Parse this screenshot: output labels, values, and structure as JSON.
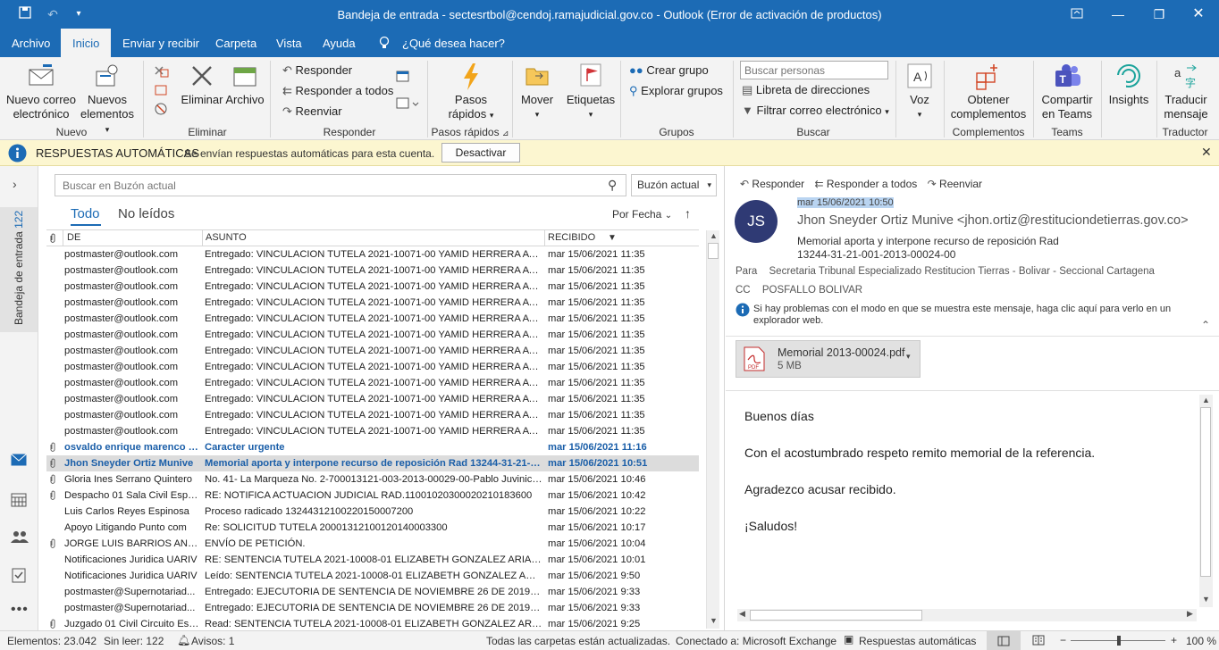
{
  "titlebar": {
    "title": "Bandeja de entrada - sectesrtbol@cendoj.ramajudicial.gov.co  -  Outlook (Error de activación de productos)"
  },
  "menu": {
    "tabs": [
      "Archivo",
      "Inicio",
      "Enviar y recibir",
      "Carpeta",
      "Vista",
      "Ayuda"
    ],
    "tell_me": "¿Qué desea hacer?"
  },
  "ribbon": {
    "new_email": "Nuevo correo electrónico",
    "new_email_l1": "Nuevo correo",
    "new_email_l2": "electrónico",
    "new_items_l1": "Nuevos",
    "new_items_l2": "elementos",
    "group_new": "Nuevo",
    "delete": "Eliminar",
    "archive": "Archivo",
    "group_delete": "Eliminar",
    "reply": "Responder",
    "reply_all": "Responder a todos",
    "forward": "Reenviar",
    "group_respond": "Responder",
    "quick_steps_l1": "Pasos",
    "quick_steps_l2": "rápidos",
    "group_quick": "Pasos rápidos",
    "move": "Mover",
    "tags": "Etiquetas",
    "create_group": "Crear grupo",
    "browse_groups": "Explorar grupos",
    "group_groups": "Grupos",
    "search_people_placeholder": "Buscar personas",
    "address_book": "Libreta de direcciones",
    "filter_email": "Filtrar correo electrónico",
    "group_find": "Buscar",
    "voice": "Voz",
    "get_addins_l1": "Obtener",
    "get_addins_l2": "complementos",
    "group_addins": "Complementos",
    "share_teams_l1": "Compartir",
    "share_teams_l2": "en Teams",
    "group_teams": "Teams",
    "insights": "Insights",
    "translate_l1": "Traducir",
    "translate_l2": "mensaje",
    "group_translator": "Traductor"
  },
  "infobar": {
    "title": "RESPUESTAS AUTOMÁTICAS",
    "message": "Se envían respuestas automáticas para esta cuenta.",
    "button": "Desactivar"
  },
  "leftnav": {
    "folder": "Bandeja de entrada",
    "count": "122"
  },
  "list": {
    "search_placeholder": "Buscar en Buzón actual",
    "scope": "Buzón actual",
    "tab_all": "Todo",
    "tab_unread": "No leídos",
    "sort": "Por Fecha",
    "col_from": "DE",
    "col_subject": "ASUNTO",
    "col_received": "RECIBIDO",
    "rows": [
      {
        "from": "postmaster@outlook.com",
        "subject": "Entregado: VINCULACION TUTELA 2021-10071-00 YAMID HERRERA AVILE...",
        "date": "mar 15/06/2021 11:35"
      },
      {
        "from": "postmaster@outlook.com",
        "subject": "Entregado: VINCULACION TUTELA 2021-10071-00 YAMID HERRERA AVILE...",
        "date": "mar 15/06/2021 11:35"
      },
      {
        "from": "postmaster@outlook.com",
        "subject": "Entregado: VINCULACION TUTELA 2021-10071-00 YAMID HERRERA AVILE...",
        "date": "mar 15/06/2021 11:35"
      },
      {
        "from": "postmaster@outlook.com",
        "subject": "Entregado: VINCULACION TUTELA 2021-10071-00 YAMID HERRERA AVILE...",
        "date": "mar 15/06/2021 11:35"
      },
      {
        "from": "postmaster@outlook.com",
        "subject": "Entregado: VINCULACION TUTELA 2021-10071-00 YAMID HERRERA AVILE...",
        "date": "mar 15/06/2021 11:35"
      },
      {
        "from": "postmaster@outlook.com",
        "subject": "Entregado: VINCULACION TUTELA 2021-10071-00 YAMID HERRERA AVILE...",
        "date": "mar 15/06/2021 11:35"
      },
      {
        "from": "postmaster@outlook.com",
        "subject": "Entregado: VINCULACION TUTELA 2021-10071-00 YAMID HERRERA AVILE...",
        "date": "mar 15/06/2021 11:35"
      },
      {
        "from": "postmaster@outlook.com",
        "subject": "Entregado: VINCULACION TUTELA 2021-10071-00 YAMID HERRERA AVILE...",
        "date": "mar 15/06/2021 11:35"
      },
      {
        "from": "postmaster@outlook.com",
        "subject": "Entregado: VINCULACION TUTELA 2021-10071-00 YAMID HERRERA AVILE...",
        "date": "mar 15/06/2021 11:35"
      },
      {
        "from": "postmaster@outlook.com",
        "subject": "Entregado: VINCULACION TUTELA 2021-10071-00 YAMID HERRERA AVILE...",
        "date": "mar 15/06/2021 11:35"
      },
      {
        "from": "postmaster@outlook.com",
        "subject": "Entregado: VINCULACION TUTELA 2021-10071-00 YAMID HERRERA AVILE...",
        "date": "mar 15/06/2021 11:35"
      },
      {
        "from": "postmaster@outlook.com",
        "subject": "Entregado: VINCULACION TUTELA 2021-10071-00 YAMID HERRERA AVILE...",
        "date": "mar 15/06/2021 11:35"
      },
      {
        "from": "osvaldo enrique marenco lu...",
        "subject": "Caracter urgente",
        "date": "mar 15/06/2021 11:16",
        "clip": true,
        "unread": true
      },
      {
        "from": "Jhon Sneyder Ortiz Munive",
        "subject": "Memorial aporta y interpone recurso de reposición Rad 13244-31-21-00...",
        "date": "mar 15/06/2021 10:51",
        "clip": true,
        "selected": true
      },
      {
        "from": "Gloria Ines Serrano Quintero",
        "subject": "No. 41- La Marqueza No. 2-700013121-003-2013-00029-00-Pablo Juvinici...",
        "date": "mar 15/06/2021 10:46",
        "clip": true
      },
      {
        "from": "Despacho 01 Sala Civil Espec...",
        "subject": "RE: NOTIFICA ACTUACION JUDICIAL RAD.11001020300020210183600",
        "date": "mar 15/06/2021 10:42",
        "clip": true
      },
      {
        "from": "Luis Carlos Reyes Espinosa",
        "subject": "Proceso radicado 13244312100220150007200",
        "date": "mar 15/06/2021 10:22"
      },
      {
        "from": "Apoyo Litigando Punto com",
        "subject": "Re: SOLICITUD TUTELA 20001312100120140003300",
        "date": "mar 15/06/2021 10:17"
      },
      {
        "from": "JORGE LUIS BARRIOS ANGULO",
        "subject": "ENVÍO DE PETICIÓN.",
        "date": "mar 15/06/2021 10:04",
        "clip": true
      },
      {
        "from": "Notificaciones Juridica UARIV",
        "subject": "RE: SENTENCIA TUTELA 2021-10008-01 ELIZABETH GONZALEZ ARIAS RAD. ...",
        "date": "mar 15/06/2021 10:01"
      },
      {
        "from": "Notificaciones Juridica UARIV",
        "subject": "Leído: SENTENCIA TUTELA 2021-10008-01 ELIZABETH GONZALEZ ARIAS RA...",
        "date": "mar 15/06/2021 9:50"
      },
      {
        "from": "postmaster@Supernotariad...",
        "subject": "Entregado: EJECUTORIA DE SENTENCIA DE NOVIEMBRE 26 DE 2019 RAD:...",
        "date": "mar 15/06/2021 9:33"
      },
      {
        "from": "postmaster@Supernotariad...",
        "subject": "Entregado: EJECUTORIA DE SENTENCIA DE NOVIEMBRE 26 DE 2019 RAD:...",
        "date": "mar 15/06/2021 9:33"
      },
      {
        "from": "Juzgado 01 Civil Circuito Esp...",
        "subject": "Read: SENTENCIA TUTELA 2021-10008-01 ELIZABETH GONZALEZ ARIAS RAD...",
        "date": "mar 15/06/2021 9:25",
        "clip": true
      }
    ]
  },
  "reading": {
    "reply": "Responder",
    "reply_all": "Responder a todos",
    "forward": "Reenviar",
    "date": "mar 15/06/2021 10:50",
    "initials": "JS",
    "sender": "Jhon Sneyder Ortiz Munive <jhon.ortiz@restituciondetierras.gov.co>",
    "subject_l1": "Memorial aporta y interpone recurso de reposición Rad",
    "subject_l2": "13244-31-21-001-2013-00024-00",
    "to_label": "Para",
    "to": "Secretaria Tribunal Especializado Restitucion Tierras - Bolivar - Seccional Cartagena",
    "cc_label": "CC",
    "cc": "POSFALLO BOLIVAR",
    "notice": "Si hay problemas con el modo en que se muestra este mensaje, haga clic aquí para verlo en un explorador web.",
    "attachment_name": "Memorial 2013-00024.pdf",
    "attachment_size": "5 MB",
    "body": [
      "Buenos días",
      "Con el acostumbrado respeto remito memorial de la referencia.",
      "Agradezco acusar recibido.",
      "¡Saludos!"
    ]
  },
  "status": {
    "items": "Elementos: 23.042",
    "unread": "Sin leer: 122",
    "reminders": "Avisos: 1",
    "folders": "Todas las carpetas están actualizadas.",
    "connected": "Conectado a: Microsoft Exchange",
    "auto_reply": "Respuestas automáticas",
    "zoom": "100 %"
  },
  "colors": {
    "accent": "#1c6bb5",
    "unread": "#1a5ea8",
    "infobar": "#fcf6d0",
    "avatar": "#2f3a74"
  }
}
